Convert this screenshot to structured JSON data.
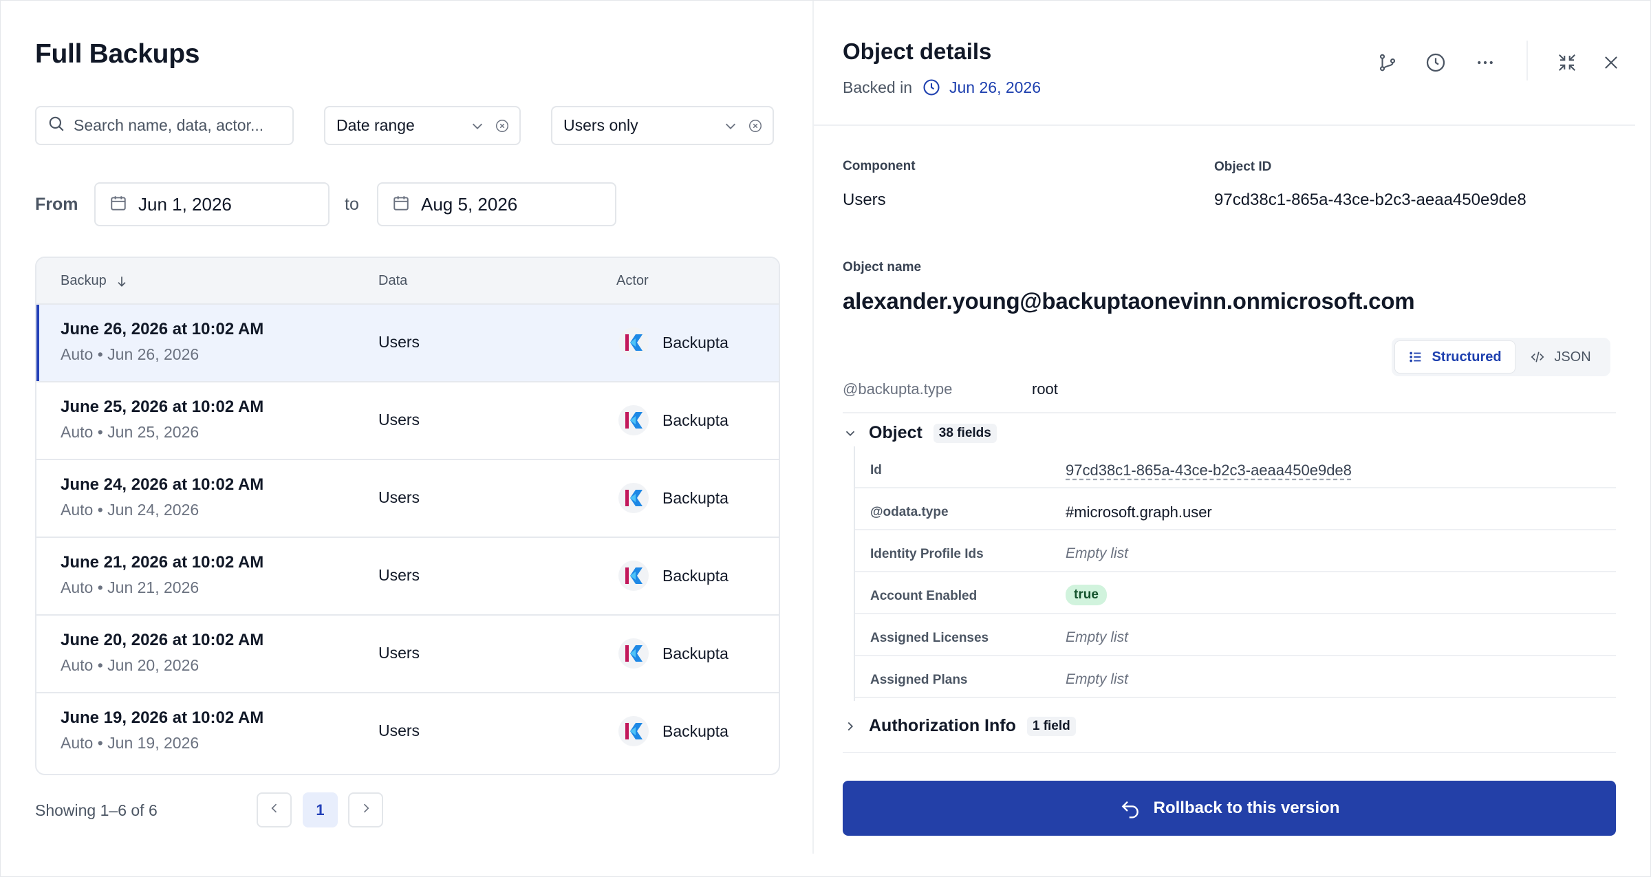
{
  "left": {
    "title": "Full Backups",
    "search_placeholder": "Search name, data, actor...",
    "date_range_label": "Date range",
    "users_filter_label": "Users only",
    "from_label": "From",
    "from_date": "Jun 1, 2026",
    "to_label": "to",
    "to_date": "Aug 5, 2026",
    "columns": {
      "backup": "Backup",
      "data": "Data",
      "actor": "Actor"
    },
    "rows": [
      {
        "title": "June 26, 2026 at 10:02 AM",
        "sub": "Auto • Jun 26, 2026",
        "data": "Users",
        "actor": "Backupta"
      },
      {
        "title": "June 25, 2026 at 10:02 AM",
        "sub": "Auto • Jun 25, 2026",
        "data": "Users",
        "actor": "Backupta"
      },
      {
        "title": "June 24, 2026 at 10:02 AM",
        "sub": "Auto • Jun 24, 2026",
        "data": "Users",
        "actor": "Backupta"
      },
      {
        "title": "June 21, 2026 at 10:02 AM",
        "sub": "Auto • Jun 21, 2026",
        "data": "Users",
        "actor": "Backupta"
      },
      {
        "title": "June 20, 2026 at 10:02 AM",
        "sub": "Auto • Jun 20, 2026",
        "data": "Users",
        "actor": "Backupta"
      },
      {
        "title": "June 19, 2026 at 10:02 AM",
        "sub": "Auto • Jun 19, 2026",
        "data": "Users",
        "actor": "Backupta"
      }
    ],
    "showing": "Showing 1–6 of 6",
    "current_page": "1"
  },
  "right": {
    "title": "Object details",
    "backed_label": "Backed in",
    "backed_date": "Jun 26, 2026",
    "component_label": "Component",
    "component_value": "Users",
    "object_id_label": "Object ID",
    "object_id_value": "97cd38c1-865a-43ce-b2c3-aeaa450e9de8",
    "object_name_label": "Object name",
    "object_name_value": "alexander.young@backuptaonevinn.onmicrosoft.com",
    "view_structured": "Structured",
    "view_json": "JSON",
    "type_key": "@backupta.type",
    "type_value": "root",
    "object_section": {
      "name": "Object",
      "badge": "38 fields"
    },
    "fields": [
      {
        "key": "Id",
        "value": "97cd38c1-865a-43ce-b2c3-aeaa450e9de8"
      },
      {
        "key": "@odata.type",
        "value": "#microsoft.graph.user"
      },
      {
        "key": "Identity Profile Ids",
        "value": "Empty list"
      },
      {
        "key": "Account Enabled",
        "value": "true"
      },
      {
        "key": "Assigned Licenses",
        "value": "Empty list"
      },
      {
        "key": "Assigned Plans",
        "value": "Empty list"
      }
    ],
    "auth_section": {
      "name": "Authorization Info",
      "badge": "1 field"
    },
    "rollback_label": "Rollback to this version"
  },
  "colors": {
    "accent": "#2340a8",
    "selected_row": "#eef3fd",
    "true_pill": "#d1f3dd"
  },
  "icons": [
    "search-icon",
    "chevron-down-icon",
    "clear-icon",
    "calendar-icon",
    "sort-down-icon",
    "backupta-logo",
    "chevron-left-icon",
    "chevron-right-icon",
    "branch-icon",
    "history-icon",
    "more-icon",
    "collapse-icon",
    "close-icon",
    "clock-icon",
    "list-icon",
    "code-icon",
    "undo-icon"
  ]
}
